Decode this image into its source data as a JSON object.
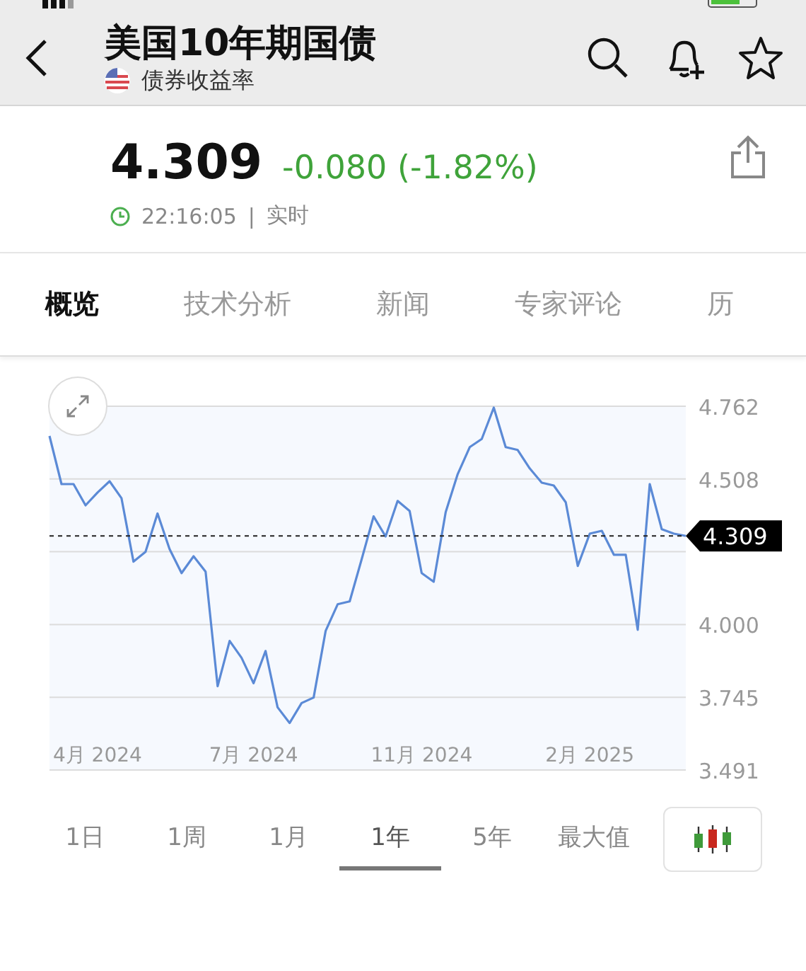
{
  "header": {
    "title": "美国10年期国债",
    "subtitle": "债券收益率"
  },
  "quote": {
    "price": "4.309",
    "change": "-0.080 (-1.82%)",
    "time": "22:16:05",
    "separator": "|",
    "mode": "实时"
  },
  "tabs": [
    {
      "label": "概览",
      "selected": true
    },
    {
      "label": "技术分析",
      "selected": false
    },
    {
      "label": "新闻",
      "selected": false
    },
    {
      "label": "专家评论",
      "selected": false
    },
    {
      "label": "历",
      "selected": false
    }
  ],
  "chart": {
    "chart_data": {
      "type": "line",
      "ylim": [
        3.491,
        4.762
      ],
      "grid": true,
      "ref_lines": [
        {
          "axis": "y",
          "value": 4.309,
          "label": "4.309"
        }
      ],
      "yticks": [
        4.762,
        4.508,
        {
          "value": 4.0,
          "label": "4.000"
        },
        3.745,
        3.491
      ],
      "categories": [
        null,
        null,
        null,
        null,
        "4月 2024",
        null,
        null,
        null,
        null,
        null,
        null,
        null,
        null,
        null,
        null,
        null,
        null,
        "7月 2024",
        null,
        null,
        null,
        null,
        null,
        null,
        null,
        null,
        null,
        null,
        null,
        null,
        null,
        "11月 2024",
        null,
        null,
        null,
        null,
        null,
        null,
        null,
        null,
        null,
        null,
        null,
        null,
        null,
        "2月 2025",
        null,
        null,
        null,
        null,
        null,
        null,
        null,
        null
      ],
      "series": [
        {
          "color": "#5b8ad6",
          "values": [
            4.658,
            4.49,
            4.49,
            4.416,
            4.461,
            4.5,
            4.441,
            4.219,
            4.253,
            4.387,
            4.263,
            4.179,
            4.238,
            4.184,
            3.784,
            3.942,
            3.883,
            3.794,
            3.907,
            3.71,
            3.655,
            3.725,
            3.744,
            3.977,
            4.07,
            4.08,
            4.228,
            4.377,
            4.307,
            4.431,
            4.396,
            4.179,
            4.149,
            4.392,
            4.525,
            4.619,
            4.648,
            4.757,
            4.619,
            4.609,
            4.545,
            4.495,
            4.485,
            4.426,
            4.204,
            4.317,
            4.327,
            4.243,
            4.243,
            3.981,
            4.49,
            4.332,
            4.317,
            4.309
          ]
        }
      ]
    }
  },
  "ranges": [
    {
      "label": "1日",
      "selected": false
    },
    {
      "label": "1周",
      "selected": false
    },
    {
      "label": "1月",
      "selected": false
    },
    {
      "label": "1年",
      "selected": true
    },
    {
      "label": "5年",
      "selected": false
    },
    {
      "label": "最大值",
      "selected": false
    }
  ]
}
